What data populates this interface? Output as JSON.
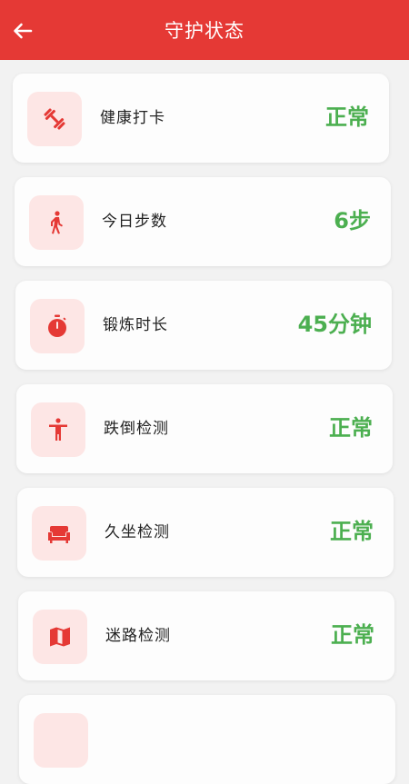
{
  "header": {
    "title": "守护状态",
    "back_icon": "arrow-left-icon"
  },
  "colors": {
    "header_bg": "#e53935",
    "icon_bg": "#fde6e5",
    "icon_fg": "#e53935",
    "value": "#4caf50"
  },
  "items": [
    {
      "icon": "dumbbell-icon",
      "label": "健康打卡",
      "value": "正常"
    },
    {
      "icon": "walking-person-icon",
      "label": "今日步数",
      "value": "6步"
    },
    {
      "icon": "stopwatch-icon",
      "label": "锻炼时长",
      "value": "45分钟"
    },
    {
      "icon": "person-fall-icon",
      "label": "跌倒检测",
      "value": "正常"
    },
    {
      "icon": "sofa-icon",
      "label": "久坐检测",
      "value": "正常"
    },
    {
      "icon": "map-icon",
      "label": "迷路检测",
      "value": "正常"
    },
    {
      "icon": "",
      "label": "",
      "value": ""
    }
  ]
}
